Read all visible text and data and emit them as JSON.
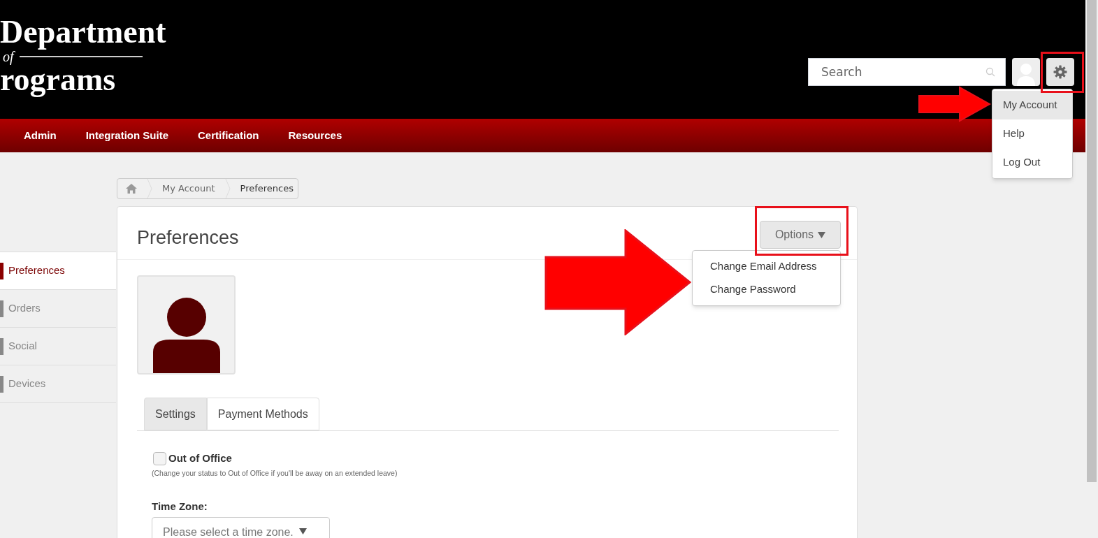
{
  "logo": {
    "line_1": "Department",
    "line_2": "of",
    "line_3": "rograms"
  },
  "search": {
    "placeholder": "Search"
  },
  "user_menu": {
    "expanded": true,
    "items": [
      {
        "label": "My Account",
        "selected": true
      },
      {
        "label": "Help",
        "selected": false
      },
      {
        "label": "Log Out",
        "selected": false
      }
    ]
  },
  "nav": [
    "Admin",
    "Integration Suite",
    "Certification",
    "Resources"
  ],
  "breadcrumb": [
    "My Account",
    "Preferences"
  ],
  "sidebar": {
    "items": [
      {
        "label": "Preferences",
        "selected": true
      },
      {
        "label": "Orders",
        "selected": false
      },
      {
        "label": "Social",
        "selected": false
      },
      {
        "label": "Devices",
        "selected": false
      }
    ]
  },
  "page": {
    "title": "Preferences",
    "options_button": "Options",
    "options_menu": {
      "expanded": true,
      "items": [
        "Change Email Address",
        "Change Password"
      ]
    }
  },
  "tabs": [
    {
      "label": "Settings",
      "selected": true
    },
    {
      "label": "Payment Methods",
      "selected": false
    }
  ],
  "out_of_office": {
    "label": "Out of Office",
    "checked": false,
    "hint": "(Change your status to Out of Office if you'll be away on an extended leave)"
  },
  "time_zone": {
    "label": "Time Zone:",
    "placeholder": "Please select a time zone."
  }
}
